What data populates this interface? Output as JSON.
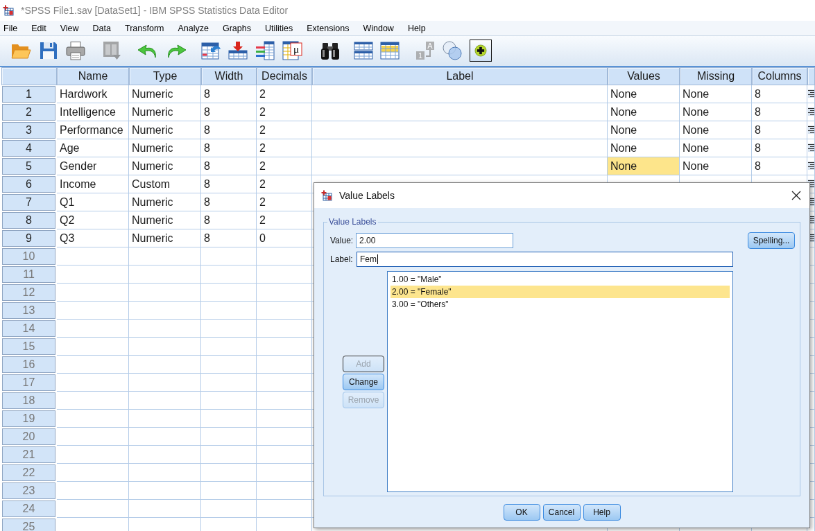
{
  "window": {
    "title": "*SPSS File1.sav [DataSet1] - IBM SPSS Statistics Data Editor"
  },
  "menu": [
    "File",
    "Edit",
    "View",
    "Data",
    "Transform",
    "Analyze",
    "Graphs",
    "Utilities",
    "Extensions",
    "Window",
    "Help"
  ],
  "toolbar": [
    {
      "kind": "open",
      "disabled": false,
      "on": false
    },
    {
      "kind": "save",
      "disabled": false,
      "on": false
    },
    {
      "kind": "print",
      "disabled": false,
      "on": false
    },
    {
      "kind": "recall",
      "disabled": true,
      "on": false
    },
    {
      "kind": "undo",
      "disabled": false,
      "on": false
    },
    {
      "kind": "redo",
      "disabled": false,
      "on": false
    },
    {
      "kind": "case",
      "disabled": false,
      "on": false
    },
    {
      "kind": "variable",
      "disabled": false,
      "on": false
    },
    {
      "kind": "variables",
      "disabled": false,
      "on": false
    },
    {
      "kind": "labels",
      "disabled": false,
      "on": false,
      "glyphs": [
        "μ"
      ]
    },
    {
      "kind": "find",
      "disabled": false,
      "on": false
    },
    {
      "kind": "split",
      "disabled": false,
      "on": false
    },
    {
      "kind": "select",
      "disabled": false,
      "on": false
    },
    {
      "kind": "values",
      "disabled": true,
      "on": false,
      "glyphs": [
        "A",
        "1"
      ]
    },
    {
      "kind": "sets",
      "disabled": false,
      "on": false
    },
    {
      "kind": "show",
      "disabled": false,
      "on": true
    }
  ],
  "grid": {
    "columns": [
      "Name",
      "Type",
      "Width",
      "Decimals",
      "Label",
      "Values",
      "Missing",
      "Columns"
    ],
    "rows": [
      {
        "number": "1",
        "defined": true,
        "cells": [
          {
            "text": "Hardwork",
            "selected": false
          },
          {
            "text": "Numeric",
            "selected": false
          },
          {
            "text": "8",
            "selected": false
          },
          {
            "text": "2",
            "selected": false
          },
          {
            "selected": false
          },
          {
            "text": "None",
            "selected": false
          },
          {
            "text": "None",
            "selected": false
          },
          {
            "text": "8",
            "selected": false
          }
        ]
      },
      {
        "number": "2",
        "defined": true,
        "cells": [
          {
            "text": "Intelligence",
            "selected": false
          },
          {
            "text": "Numeric",
            "selected": false
          },
          {
            "text": "8",
            "selected": false
          },
          {
            "text": "2",
            "selected": false
          },
          {
            "selected": false
          },
          {
            "text": "None",
            "selected": false
          },
          {
            "text": "None",
            "selected": false
          },
          {
            "text": "8",
            "selected": false
          }
        ]
      },
      {
        "number": "3",
        "defined": true,
        "cells": [
          {
            "text": "Performance",
            "selected": false
          },
          {
            "text": "Numeric",
            "selected": false
          },
          {
            "text": "8",
            "selected": false
          },
          {
            "text": "2",
            "selected": false
          },
          {
            "selected": false
          },
          {
            "text": "None",
            "selected": false
          },
          {
            "text": "None",
            "selected": false
          },
          {
            "text": "8",
            "selected": false
          }
        ]
      },
      {
        "number": "4",
        "defined": true,
        "cells": [
          {
            "text": "Age",
            "selected": false
          },
          {
            "text": "Numeric",
            "selected": false
          },
          {
            "text": "8",
            "selected": false
          },
          {
            "text": "2",
            "selected": false
          },
          {
            "selected": false
          },
          {
            "text": "None",
            "selected": false
          },
          {
            "text": "None",
            "selected": false
          },
          {
            "text": "8",
            "selected": false
          }
        ]
      },
      {
        "number": "5",
        "defined": true,
        "cells": [
          {
            "text": "Gender",
            "selected": false
          },
          {
            "text": "Numeric",
            "selected": false
          },
          {
            "text": "8",
            "selected": false
          },
          {
            "text": "2",
            "selected": false
          },
          {
            "selected": false
          },
          {
            "text": "None",
            "selected": true
          },
          {
            "text": "None",
            "selected": false
          },
          {
            "text": "8",
            "selected": false
          }
        ]
      },
      {
        "number": "6",
        "defined": true,
        "cells": [
          {
            "text": "Income",
            "selected": false
          },
          {
            "text": "Custom",
            "selected": false
          },
          {
            "text": "8",
            "selected": false
          },
          {
            "text": "2",
            "selected": false
          },
          {
            "selected": false
          },
          {
            "selected": false
          },
          {
            "selected": false
          },
          {
            "selected": false
          }
        ]
      },
      {
        "number": "7",
        "defined": true,
        "cells": [
          {
            "text": "Q1",
            "selected": false
          },
          {
            "text": "Numeric",
            "selected": false
          },
          {
            "text": "8",
            "selected": false
          },
          {
            "text": "2",
            "selected": false
          }
        ]
      },
      {
        "number": "8",
        "defined": true,
        "cells": [
          {
            "text": "Q2",
            "selected": false
          },
          {
            "text": "Numeric",
            "selected": false
          },
          {
            "text": "8",
            "selected": false
          },
          {
            "text": "2",
            "selected": false
          }
        ]
      },
      {
        "number": "9",
        "defined": true,
        "cells": [
          {
            "text": "Q3",
            "selected": false
          },
          {
            "text": "Numeric",
            "selected": false
          },
          {
            "text": "8",
            "selected": false
          },
          {
            "text": "0",
            "selected": false
          }
        ]
      },
      {
        "number": "10",
        "defined": false
      },
      {
        "number": "11",
        "defined": false
      },
      {
        "number": "12",
        "defined": false
      },
      {
        "number": "13",
        "defined": false
      },
      {
        "number": "14",
        "defined": false
      },
      {
        "number": "15",
        "defined": false
      },
      {
        "number": "16",
        "defined": false
      },
      {
        "number": "17",
        "defined": false
      },
      {
        "number": "18",
        "defined": false
      },
      {
        "number": "19",
        "defined": false
      },
      {
        "number": "20",
        "defined": false
      },
      {
        "number": "21",
        "defined": false
      },
      {
        "number": "22",
        "defined": false
      },
      {
        "number": "23",
        "defined": false
      },
      {
        "number": "24",
        "defined": false
      },
      {
        "number": "25",
        "defined": false
      }
    ]
  },
  "dialog": {
    "title": "Value Labels",
    "group_title": "Value Labels",
    "fields": [
      {
        "label": "Value:",
        "value": "2.00",
        "focused": false
      },
      {
        "label": "Label:",
        "value": "Fem",
        "focused": true
      }
    ],
    "spelling_button": {
      "label": "Spelling..."
    },
    "labels": [
      {
        "text": "1.00 = \"Male\"",
        "selected": false
      },
      {
        "text": "2.00 = \"Female\"",
        "selected": true
      },
      {
        "text": "3.00 = \"Others\"",
        "selected": false
      }
    ],
    "actions": [
      {
        "label": "Add",
        "disabled": true,
        "focused": true
      },
      {
        "label": "Change",
        "disabled": false,
        "focused": false
      },
      {
        "label": "Remove",
        "disabled": true,
        "focused": false
      }
    ],
    "buttons": [
      "OK",
      "Cancel",
      "Help"
    ]
  }
}
